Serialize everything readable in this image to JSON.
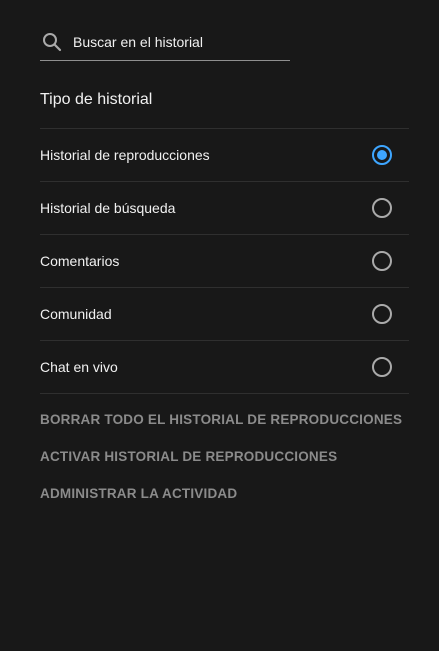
{
  "search": {
    "placeholder": "Buscar en el historial",
    "icon": "search-icon"
  },
  "history_type": {
    "title": "Tipo de historial",
    "selected": "Historial de reproducciones",
    "options": [
      {
        "label": "Historial de reproducciones",
        "checked": true
      },
      {
        "label": "Historial de búsqueda",
        "checked": false
      },
      {
        "label": "Comentarios",
        "checked": false
      },
      {
        "label": "Comunidad",
        "checked": false
      },
      {
        "label": "Chat en vivo",
        "checked": false
      }
    ]
  },
  "actions": {
    "clear_all": "BORRAR TODO EL HISTORIAL DE REPRODUCCIONES",
    "activate": "ACTIVAR HISTORIAL DE REPRODUCCIONES",
    "manage": "ADMINISTRAR LA ACTIVIDAD"
  },
  "colors": {
    "background": "#181818",
    "accent": "#3ea6ff",
    "text": "#f1f1f1",
    "muted": "#8b8b8b",
    "divider": "#2f2f2f"
  }
}
